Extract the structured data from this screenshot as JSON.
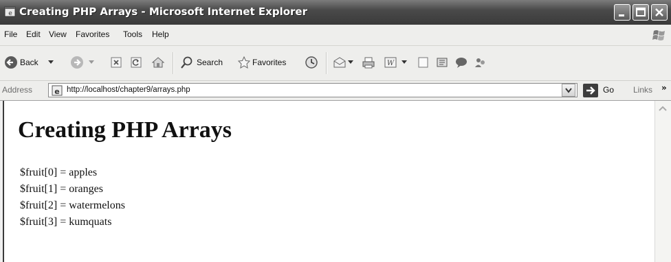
{
  "window": {
    "title": "Creating PHP Arrays - Microsoft Internet Explorer"
  },
  "menu": [
    "File",
    "Edit",
    "View",
    "Favorites",
    "Tools",
    "Help"
  ],
  "toolbar": {
    "back_label": "Back",
    "search_label": "Search",
    "favorites_label": "Favorites"
  },
  "address": {
    "label": "Address",
    "url": "http://localhost/chapter9/arrays.php",
    "go_label": "Go",
    "links_label": "Links",
    "links_chevron": "»"
  },
  "page": {
    "heading": "Creating PHP Arrays",
    "lines": [
      "$fruit[0] = apples",
      "$fruit[1] = oranges",
      "$fruit[2] = watermelons",
      "$fruit[3] = kumquats"
    ]
  }
}
